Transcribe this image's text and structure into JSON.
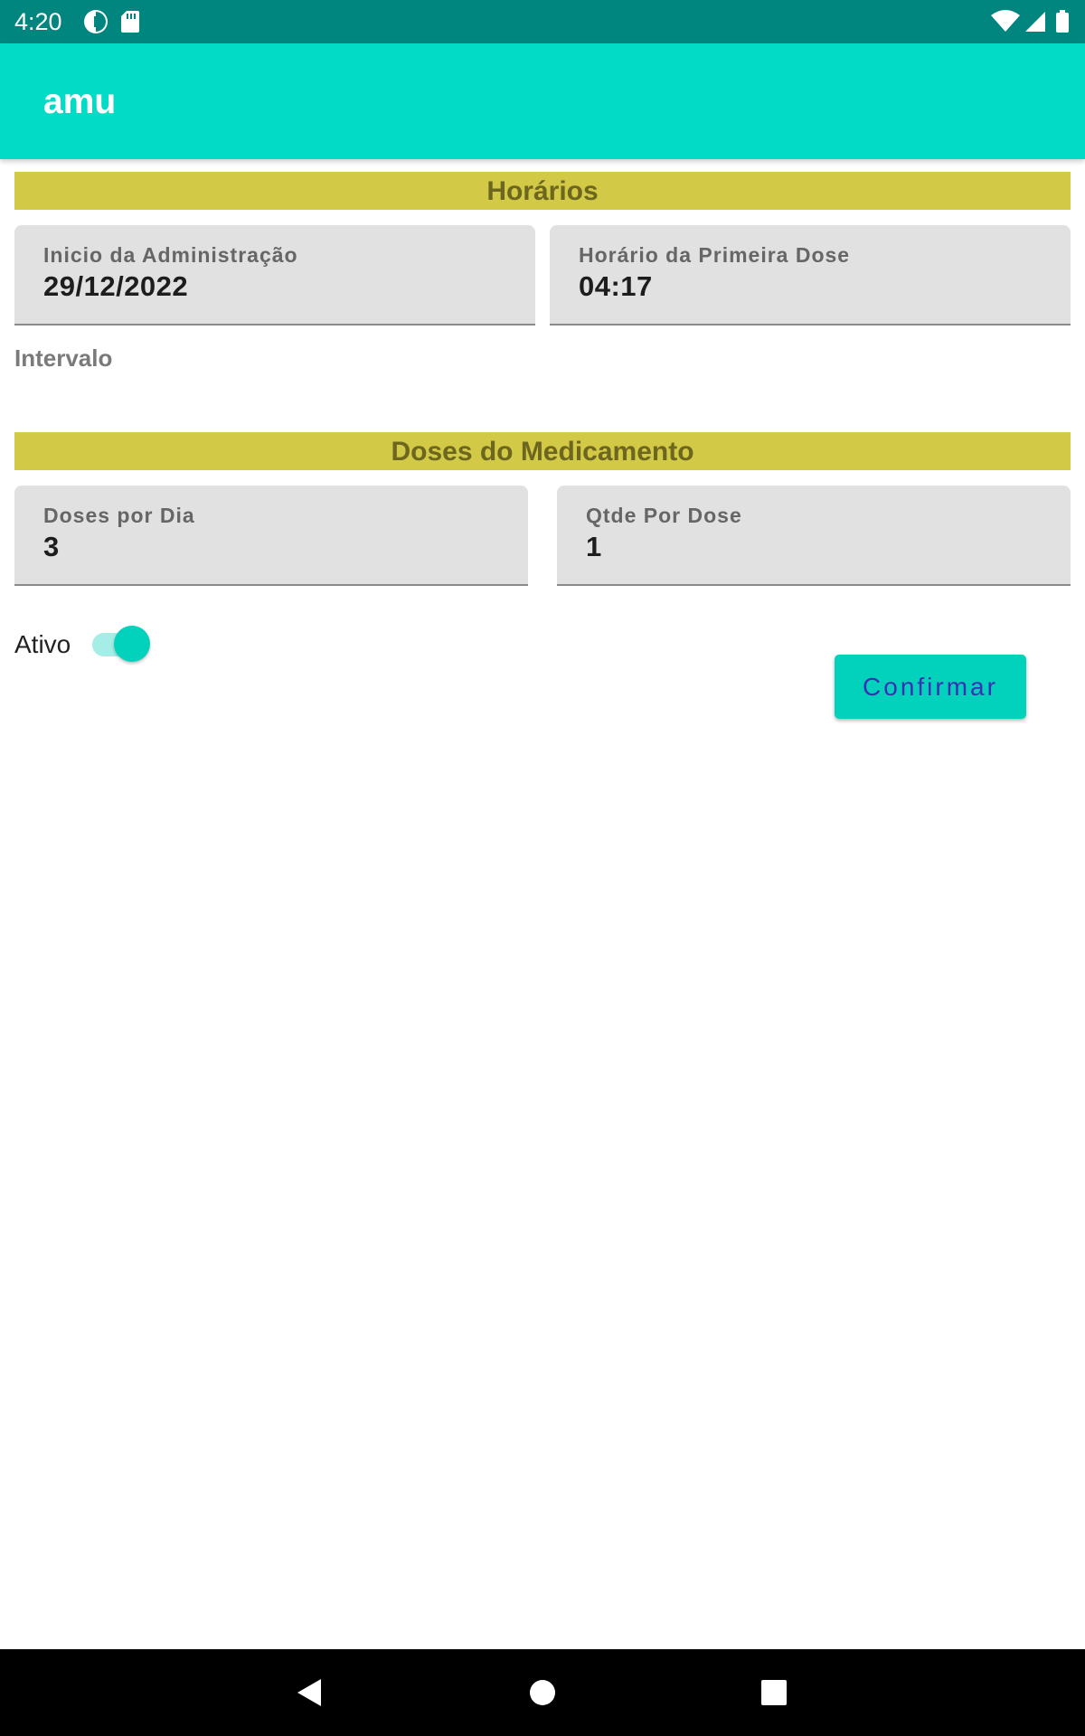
{
  "status_bar": {
    "time": "4:20",
    "left_icons": [
      "data-saver-icon",
      "sd-card-icon"
    ],
    "right_icons": [
      "wifi-icon",
      "cell-signal-icon",
      "battery-icon"
    ]
  },
  "app_bar": {
    "title": "amu"
  },
  "horarios": {
    "header": "Horários",
    "inicio_label": "Inicio da Administração",
    "inicio_value": "29/12/2022",
    "primeira_dose_label": "Horário da Primeira Dose",
    "primeira_dose_value": "04:17",
    "intervalo_label": "Intervalo"
  },
  "doses": {
    "header": "Doses do Medicamento",
    "doses_dia_label": "Doses por Dia",
    "doses_dia_value": "3",
    "qtde_label": "Qtde Por Dose",
    "qtde_value": "1"
  },
  "ativo": {
    "label": "Ativo",
    "checked": true
  },
  "confirm_button": {
    "label": "Confirmar"
  },
  "nav_bar": {
    "buttons": [
      "back-icon",
      "home-icon",
      "recents-icon"
    ]
  },
  "colors": {
    "status_bar": "#00857f",
    "app_bar": "#02dbc6",
    "section_header": "#d2c946",
    "section_header_text": "#6d661f",
    "accent": "#02d2bc",
    "button_text": "#3b2fb6"
  }
}
